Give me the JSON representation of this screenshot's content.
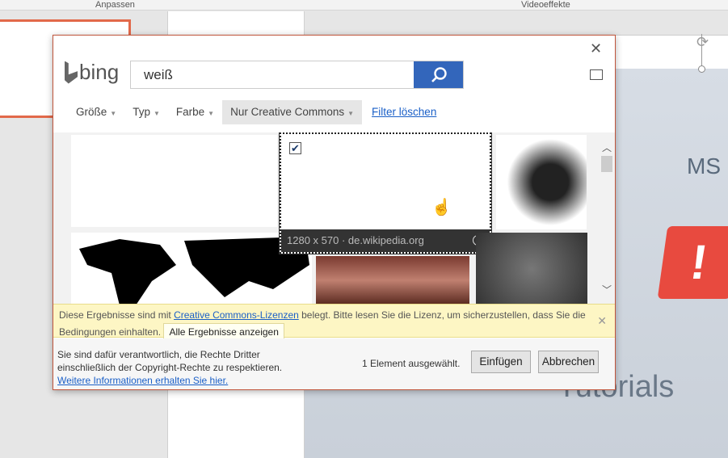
{
  "ribbon": {
    "group1": "Anpassen",
    "group2": "Videoeffekte"
  },
  "slide": {
    "text1": "MS",
    "text2": "Tutorials",
    "bubble": "!"
  },
  "dialog": {
    "logo": "bing",
    "search": {
      "value": "weiß",
      "icon": "search-icon"
    },
    "filters": [
      {
        "label": "Größe"
      },
      {
        "label": "Typ"
      },
      {
        "label": "Farbe"
      },
      {
        "label": "Nur Creative Commons"
      }
    ],
    "clear_filter": "Filter löschen",
    "selected_image": {
      "caption": "1280 x 570 · de.wikipedia.org",
      "checked": true
    },
    "notice": {
      "prefix": "Diese Ergebnisse sind mit ",
      "link": "Creative Commons-Lizenzen",
      "suffix": " belegt. Bitte lesen Sie die Lizenz, um sicherzustellen, dass Sie die Bedingungen einhalten.",
      "button": "Alle Ergebnisse anzeigen"
    },
    "footer": {
      "line1": "Sie sind dafür verantwortlich, die Rechte Dritter",
      "line2": "einschließlich der Copyright-Rechte zu respektieren.",
      "link": "Weitere Informationen erhalten Sie hier.",
      "count": "1 Element ausgewählt.",
      "insert": "Einfügen",
      "cancel": "Abbrechen"
    },
    "accent": "#3366bb"
  }
}
